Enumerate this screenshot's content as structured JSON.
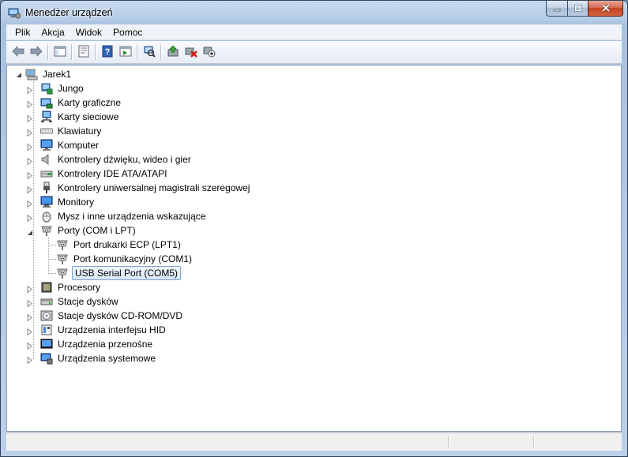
{
  "window": {
    "title": "Menedżer urządzeń"
  },
  "menu": {
    "items": [
      "Plik",
      "Akcja",
      "Widok",
      "Pomoc"
    ]
  },
  "toolbar": {
    "buttons": [
      "back-icon",
      "forward-icon",
      "show-hide-tree-icon",
      "properties-icon",
      "help-icon",
      "console-view-icon",
      "scan-hardware-icon",
      "update-driver-icon",
      "uninstall-icon",
      "disable-device-icon"
    ]
  },
  "tree": {
    "root": "Jarek1",
    "categories": [
      {
        "label": "Jungo",
        "icon": "usb-device-icon"
      },
      {
        "label": "Karty graficzne",
        "icon": "display-adapter-icon"
      },
      {
        "label": "Karty sieciowe",
        "icon": "network-adapter-icon"
      },
      {
        "label": "Klawiatury",
        "icon": "keyboard-icon"
      },
      {
        "label": "Komputer",
        "icon": "computer-icon"
      },
      {
        "label": "Kontrolery dźwięku, wideo i gier",
        "icon": "speaker-icon"
      },
      {
        "label": "Kontrolery IDE ATA/ATAPI",
        "icon": "ide-controller-icon"
      },
      {
        "label": "Kontrolery uniwersalnej magistrali szeregowej",
        "icon": "usb-plug-icon"
      },
      {
        "label": "Monitory",
        "icon": "monitor-icon"
      },
      {
        "label": "Mysz i inne urządzenia wskazujące",
        "icon": "mouse-icon"
      },
      {
        "label": "Porty (COM i LPT)",
        "icon": "port-icon",
        "expanded": true,
        "children": [
          "Port drukarki ECP (LPT1)",
          "Port komunikacyjny (COM1)",
          "USB Serial Port (COM5)"
        ],
        "selected_child": "USB Serial Port (COM5)"
      },
      {
        "label": "Procesory",
        "icon": "processor-icon"
      },
      {
        "label": "Stacje dysków",
        "icon": "disk-drive-icon"
      },
      {
        "label": "Stacje dysków CD-ROM/DVD",
        "icon": "cdrom-icon"
      },
      {
        "label": "Urządzenia interfejsu HID",
        "icon": "hid-icon"
      },
      {
        "label": "Urządzenia przenośne",
        "icon": "portable-device-icon"
      },
      {
        "label": "Urządzenia systemowe",
        "icon": "system-device-icon"
      }
    ]
  },
  "colors": {
    "selection_border": "#7da2ce",
    "selection_fill": "#d8e8fa",
    "titlebar": "#b4cbe6"
  }
}
